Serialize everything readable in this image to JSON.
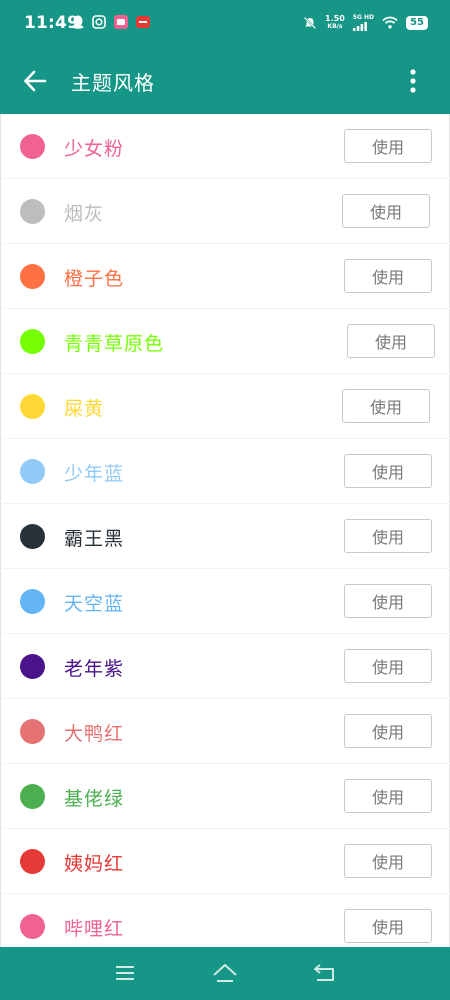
{
  "status_bar": {
    "time": "11:49",
    "net_speed_value": "1.50",
    "net_speed_unit": "KB/s",
    "network_label": "5G HD",
    "battery": "55"
  },
  "app_bar": {
    "title": "主题风格",
    "back_icon": "arrow-left-icon",
    "more_icon": "more-vert-icon"
  },
  "themes": [
    {
      "name": "少女粉",
      "color": "#f06292",
      "button": "使用"
    },
    {
      "name": "烟灰",
      "color": "#bdbdbd",
      "button": "使用"
    },
    {
      "name": "橙子色",
      "color": "#ff7043",
      "button": "使用"
    },
    {
      "name": "青青草原色",
      "color": "#76ff03",
      "button": "使用"
    },
    {
      "name": "屎黄",
      "color": "#fdd835",
      "button": "使用"
    },
    {
      "name": "少年蓝",
      "color": "#90caf9",
      "button": "使用"
    },
    {
      "name": "霸王黑",
      "color": "#263238",
      "button": "使用"
    },
    {
      "name": "天空蓝",
      "color": "#64b5f6",
      "button": "使用"
    },
    {
      "name": "老年紫",
      "color": "#4a148c",
      "button": "使用"
    },
    {
      "name": "大鸭红",
      "color": "#e57373",
      "button": "使用"
    },
    {
      "name": "基佬绿",
      "color": "#4caf50",
      "button": "使用"
    },
    {
      "name": "姨妈红",
      "color": "#e53935",
      "button": "使用"
    },
    {
      "name": "哔哩红",
      "color": "#f06292",
      "button": "使用"
    }
  ],
  "nav_bar": {
    "menu_icon": "menu-icon",
    "home_icon": "home-icon",
    "back_icon": "back-icon"
  },
  "colors": {
    "primary": "#159687"
  }
}
